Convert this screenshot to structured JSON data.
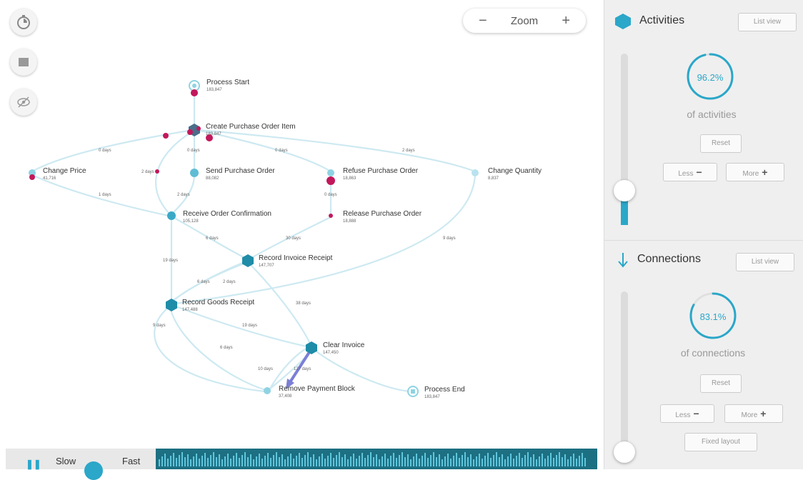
{
  "toolbar": {
    "zoom_label": "Zoom",
    "zoom_minus": "−",
    "zoom_plus": "+"
  },
  "graph": {
    "nodes": {
      "process_start": {
        "label": "Process Start",
        "count": "183,847"
      },
      "create_po_item": {
        "label": "Create Purchase Order Item",
        "count": "183,847"
      },
      "change_price": {
        "label": "Change Price",
        "count": "41,716"
      },
      "send_po": {
        "label": "Send Purchase Order",
        "count": "88,082"
      },
      "refuse_po": {
        "label": "Refuse Purchase Order",
        "count": "18,863"
      },
      "change_quantity": {
        "label": "Change Quantity",
        "count": "8,837"
      },
      "receive_order_confirmation": {
        "label": "Receive Order Confirmation",
        "count": "105,128"
      },
      "release_po": {
        "label": "Release Purchase Order",
        "count": "18,888"
      },
      "record_invoice_receipt": {
        "label": "Record Invoice Receipt",
        "count": "147,707"
      },
      "record_goods_receipt": {
        "label": "Record Goods Receipt",
        "count": "147,488"
      },
      "clear_invoice": {
        "label": "Clear Invoice",
        "count": "147,450"
      },
      "remove_payment_block": {
        "label": "Remove Payment Block",
        "count": "37,408"
      },
      "process_end": {
        "label": "Process End",
        "count": "183,847"
      }
    },
    "edges": {
      "e1": "0 days",
      "e2": "0 days",
      "e3": "0 days",
      "e4": "2 days",
      "e5": "2 days",
      "e6": "1 days",
      "e7": "2 days",
      "e8": "0 days",
      "e9": "6 days",
      "e10": "30 days",
      "e11": "9 days",
      "e12": "19 days",
      "e13": "6 days",
      "e14": "2 days",
      "e15": "38 days",
      "e16": "19 days",
      "e17": "9 days",
      "e18": "6 days",
      "e19": "10 days",
      "e20": "127 days"
    }
  },
  "timeline": {
    "slow_label": "Slow",
    "fast_label": "Fast",
    "play_icon": "pause"
  },
  "activities": {
    "title": "Activities",
    "list_view": "List view",
    "percent": "96.2%",
    "percent_value": 0.962,
    "of_label": "of activities",
    "reset": "Reset",
    "less": "Less",
    "more": "More",
    "slider_level": 0.2
  },
  "connections": {
    "title": "Connections",
    "list_view": "List view",
    "percent": "83.1%",
    "percent_value": 0.831,
    "of_label": "of connections",
    "reset": "Reset",
    "less": "Less",
    "more": "More",
    "fixed_layout": "Fixed layout",
    "slider_level": 0.0
  },
  "colors": {
    "accent": "#2aa7c9",
    "node_dark": "#1f8ca8",
    "node_light": "#8fd3e3",
    "token_pink": "#c2185b",
    "edge": "#cde9f1"
  }
}
